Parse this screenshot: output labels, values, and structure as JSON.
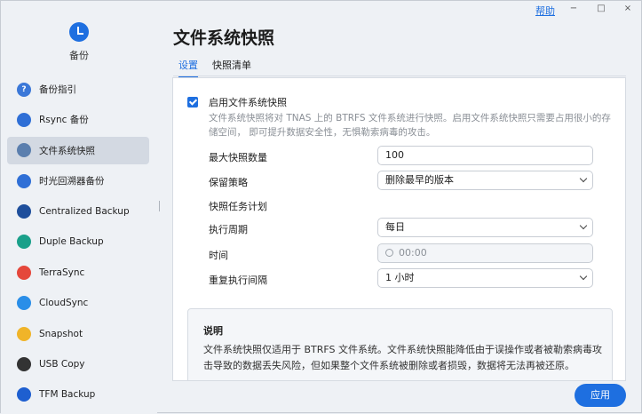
{
  "app": {
    "name": "备份"
  },
  "topbar": {
    "help": "帮助",
    "minimize": "−",
    "maximize": "□",
    "close": "×"
  },
  "sidebar": {
    "items": [
      {
        "label": "备份指引",
        "icon": "question-mark-icon",
        "color": "#3b78d8",
        "glyph": "?"
      },
      {
        "label": "Rsync 备份",
        "icon": "rsync-icon",
        "color": "#2f6fd6",
        "glyph": ""
      },
      {
        "label": "文件系统快照",
        "icon": "snapshot-document-icon",
        "color": "#5b7fae",
        "glyph": "",
        "active": true
      },
      {
        "label": "时光回溯器备份",
        "icon": "time-machine-icon",
        "color": "#2f6fd6",
        "glyph": ""
      },
      {
        "label": "Centralized Backup",
        "icon": "centralized-backup-icon",
        "color": "#1f4f9c",
        "glyph": ""
      },
      {
        "label": "Duple Backup",
        "icon": "duple-backup-icon",
        "color": "#1aa08a",
        "glyph": ""
      },
      {
        "label": "TerraSync",
        "icon": "terrasync-icon",
        "color": "#e5473b",
        "glyph": ""
      },
      {
        "label": "CloudSync",
        "icon": "cloudsync-icon",
        "color": "#2a8ee8",
        "glyph": ""
      },
      {
        "label": "Snapshot",
        "icon": "folder-icon",
        "color": "#f0b429",
        "glyph": ""
      },
      {
        "label": "USB Copy",
        "icon": "usb-icon",
        "color": "#333333",
        "glyph": ""
      },
      {
        "label": "TFM Backup",
        "icon": "tfm-backup-icon",
        "color": "#1e5fd0",
        "glyph": ""
      }
    ]
  },
  "page": {
    "title": "文件系统快照",
    "tabs": [
      {
        "label": "设置",
        "active": true
      },
      {
        "label": "快照清单"
      }
    ]
  },
  "settings": {
    "enable_label": "启用文件系统快照",
    "enable_checked": true,
    "description": "文件系统快照将对 TNAS 上的 BTRFS 文件系统进行快照。启用文件系统快照只需要占用很小的存储空间， 即可提升数据安全性，无惧勒索病毒的攻击。",
    "max_label": "最大快照数量",
    "max_value": "100",
    "retention_label": "保留策略",
    "retention_value": "删除最早的版本",
    "plan_label": "快照任务计划",
    "period_label": "执行周期",
    "period_value": "每日",
    "time_label": "时间",
    "time_value": "00:00",
    "interval_label": "重复执行间隔",
    "interval_value": "1 小时"
  },
  "note": {
    "title": "说明",
    "body": "文件系统快照仅适用于 BTRFS 文件系统。文件系统快照能降低由于误操作或者被勒索病毒攻击导致的数据丢失风险，但如果整个文件系统被删除或者损毁，数据将无法再被还原。"
  },
  "footer": {
    "apply": "应用"
  },
  "colors": {
    "accent": "#1e6fe0"
  }
}
